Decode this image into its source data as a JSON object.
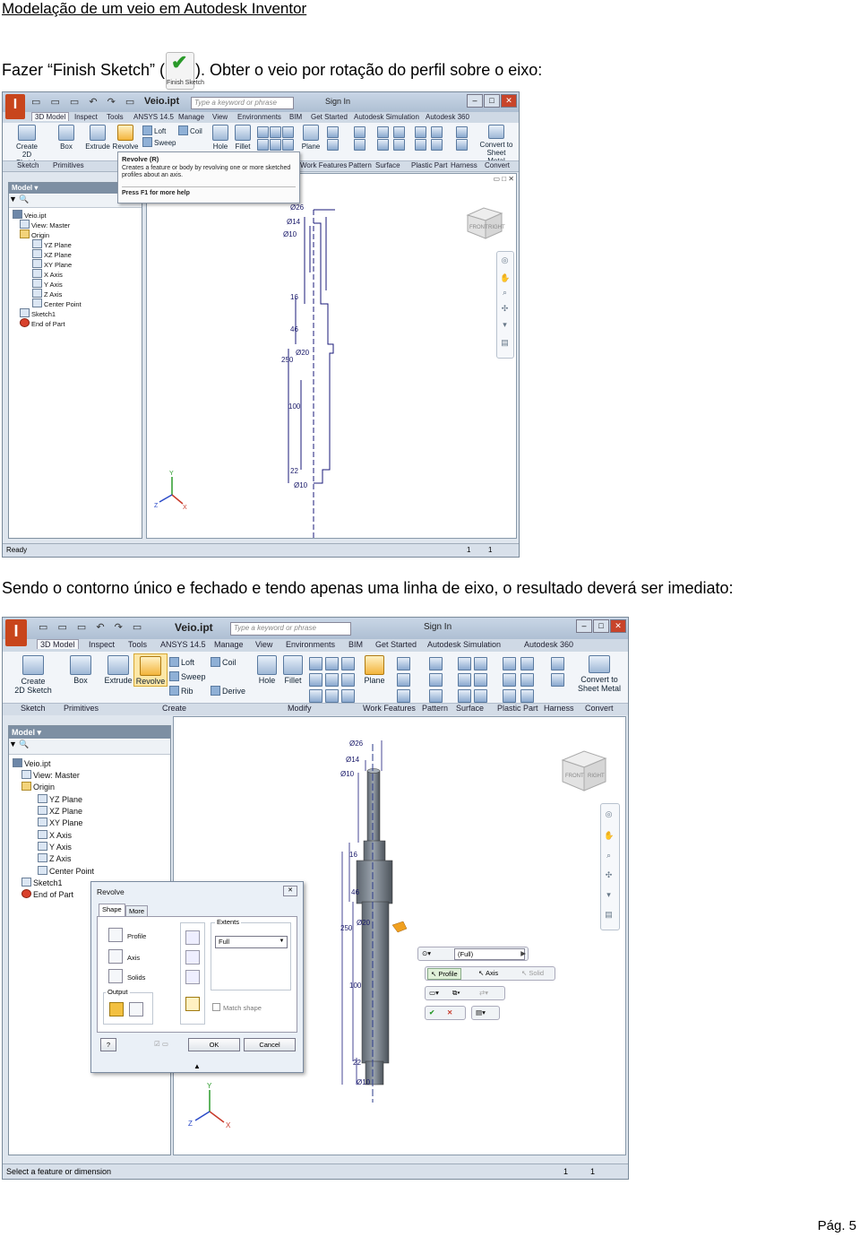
{
  "document": {
    "title": "Modelação de um veio em Autodesk Inventor",
    "para1_before": "Fazer  “Finish Sketch”  (",
    "finish_icon_label": "Finish Sketch",
    "para1_after": "). Obter o veio por rotação do perfil sobre o eixo:",
    "para2": "Sendo o contorno único e fechado e tendo apenas uma linha de eixo, o resultado deverá ser imediato:",
    "page_number": "Pág. 5"
  },
  "app": {
    "logo_text": "I",
    "logo_badge": "PRO",
    "doc_name": "Veio.ipt",
    "search_placeholder": "Type a keyword or phrase",
    "sign_in": "Sign In",
    "tabs": [
      "3D Model",
      "Inspect",
      "Tools",
      "ANSYS 14.5",
      "Manage",
      "View",
      "Environments",
      "BIM",
      "Get Started",
      "Autodesk Simulation",
      "Autodesk 360"
    ],
    "ribbon": {
      "create_2d_sketch": "Create\n2D Sketch",
      "box": "Box",
      "extrude": "Extrude",
      "revolve": "Revolve",
      "loft": "Loft",
      "sweep": "Sweep",
      "rib": "Rib",
      "coil": "Coil",
      "derive": "Derive",
      "hole": "Hole",
      "fillet": "Fillet",
      "plane": "Plane",
      "convert_to_sheet_metal": "Convert to\nSheet Metal"
    },
    "panels": [
      "Sketch",
      "Primitives",
      "Create",
      "Modify",
      "Work Features",
      "Pattern",
      "Surface",
      "Plastic Part",
      "Harness",
      "Convert"
    ],
    "browser": {
      "header": "Model",
      "items": [
        "Veio.ipt",
        "View: Master",
        "Origin",
        "YZ Plane",
        "XZ Plane",
        "XY Plane",
        "X Axis",
        "Y Axis",
        "Z Axis",
        "Center Point",
        "Sketch1",
        "End of Part"
      ]
    },
    "dimensions": {
      "d26": "Ø26",
      "d14": "Ø14",
      "d10a": "Ø10",
      "d16": "16",
      "d46": "46",
      "d250": "250",
      "d20": "Ø20",
      "d100": "100",
      "d22": "22",
      "d10b": "Ø10"
    },
    "viewcube": {
      "front": "FRONT",
      "right": "RIGHT"
    },
    "axes": {
      "x": "X",
      "y": "Y",
      "z": "Z"
    }
  },
  "screen1": {
    "tooltip": {
      "title": "Revolve (R)",
      "desc": "Creates a feature or body by revolving one or more sketched profiles about an axis.",
      "help": "Press F1 for more help"
    },
    "status": {
      "text": "Ready",
      "n1": "1",
      "n2": "1"
    }
  },
  "screen2": {
    "dialog": {
      "title": "Revolve",
      "tab_shape": "Shape",
      "tab_more": "More",
      "profile": "Profile",
      "axis": "Axis",
      "solids": "Solids",
      "output": "Output",
      "extents": "Extents",
      "extents_value": "Full",
      "match_shape": "Match shape",
      "ok": "OK",
      "cancel": "Cancel"
    },
    "minitoolbar": {
      "full": "(Full)",
      "profile": "Profile",
      "axis": "Axis",
      "solid": "Solid"
    },
    "status": {
      "text": "Select a feature or dimension",
      "n1": "1",
      "n2": "1"
    }
  }
}
